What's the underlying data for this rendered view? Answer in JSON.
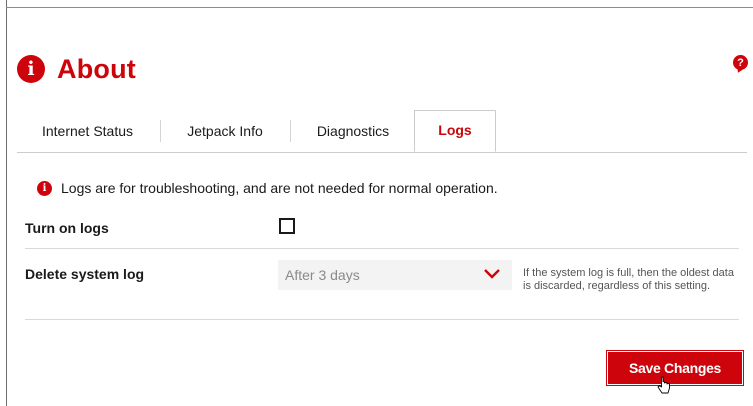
{
  "header": {
    "icon": "info-icon",
    "title": "About",
    "help_icon": "help-bubble-icon",
    "help_glyph": "?"
  },
  "tabs": [
    {
      "label": "Internet Status",
      "active": false
    },
    {
      "label": "Jetpack Info",
      "active": false
    },
    {
      "label": "Diagnostics",
      "active": false
    },
    {
      "label": "Logs",
      "active": true
    }
  ],
  "notice": {
    "icon": "info-icon",
    "text": "Logs are for troubleshooting, and are not needed for normal operation."
  },
  "settings": {
    "turn_on_logs": {
      "label": "Turn on logs",
      "checked": false
    },
    "delete_system_log": {
      "label": "Delete system log",
      "selected": "After 3 days",
      "help": "If the system log is full, then the oldest data is discarded, regardless of this setting."
    }
  },
  "actions": {
    "save_label": "Save Changes"
  },
  "colors": {
    "accent": "#cd040b",
    "text": "#1a1a1a",
    "muted": "#8a8a8a"
  }
}
